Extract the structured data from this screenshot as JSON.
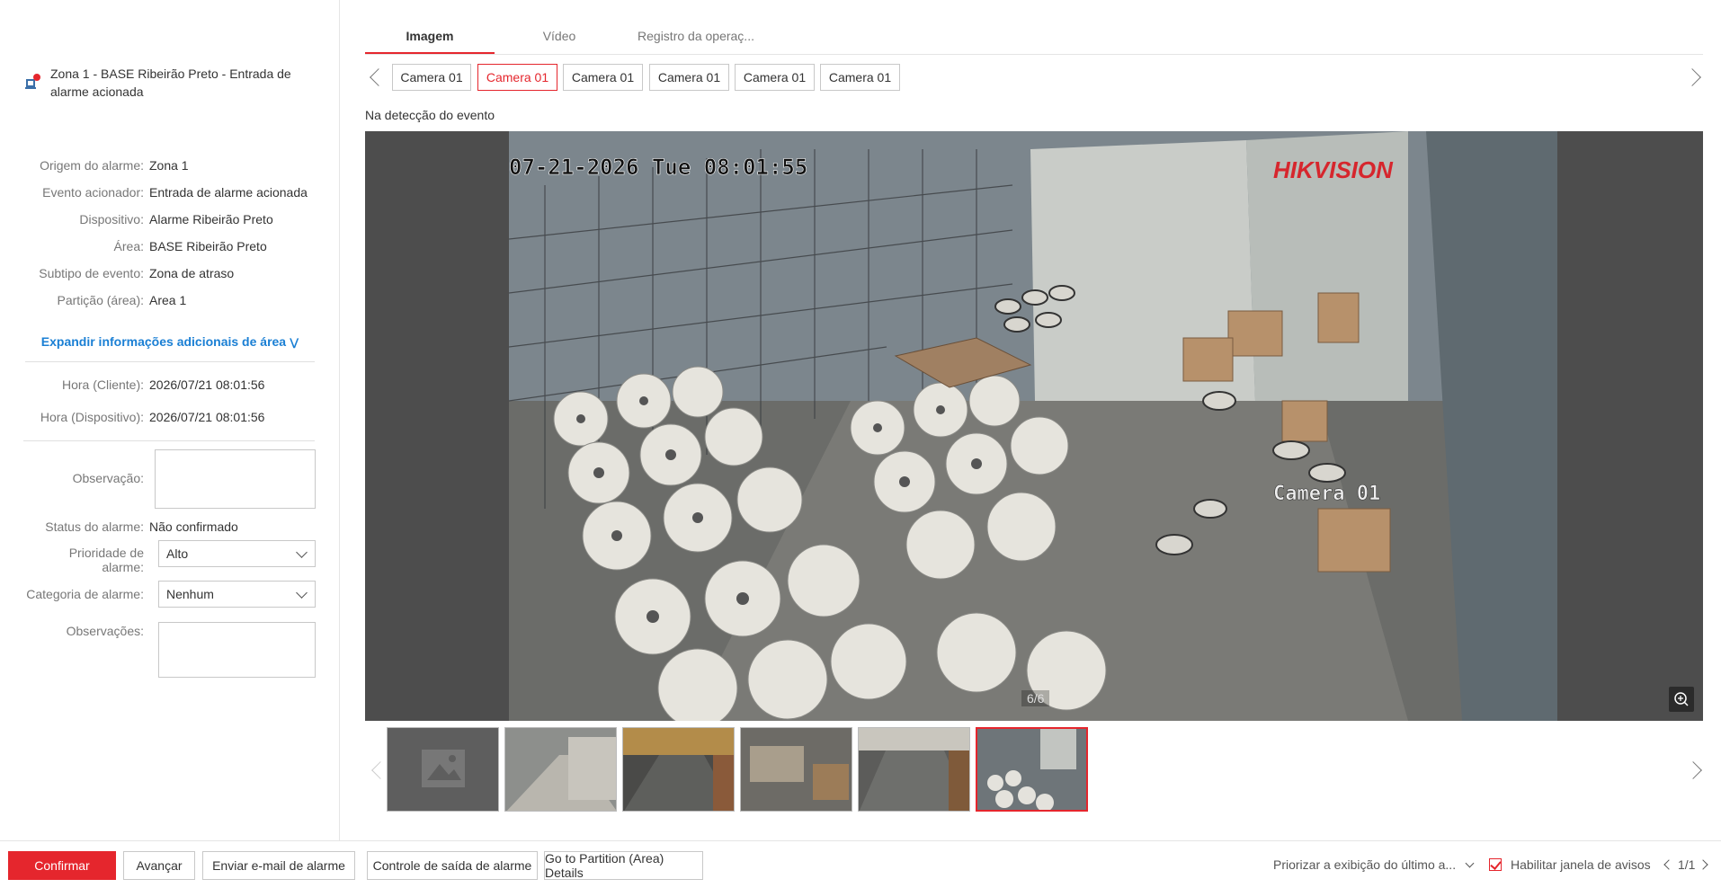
{
  "alarm": {
    "title": "Zona 1 - BASE Ribeirão Preto - Entrada de alarme acionada",
    "icon": "alarm-input-icon"
  },
  "details": [
    {
      "label": "Origem do alarme:",
      "value": "Zona 1"
    },
    {
      "label": "Evento acionador:",
      "value": "Entrada de alarme acionada"
    },
    {
      "label": "Dispositivo:",
      "value": "Alarme Ribeirão Preto"
    },
    {
      "label": "Área:",
      "value": "BASE Ribeirão Preto"
    },
    {
      "label": "Subtipo de evento:",
      "value": "Zona de atraso"
    },
    {
      "label": "Partição (área):",
      "value": "Area 1"
    }
  ],
  "expand_label": "Expandir informações adicionais de área",
  "times": [
    {
      "label": "Hora (Cliente):",
      "value": "2026/07/21 08:01:56"
    },
    {
      "label": "Hora (Dispositivo):",
      "value": "2026/07/21 08:01:56"
    }
  ],
  "form": {
    "observation_label": "Observação:",
    "observation_value": "",
    "status_label": "Status do alarme:",
    "status_value": "Não confirmado",
    "priority_label": "Prioridade de alarme:",
    "priority_value": "Alto",
    "category_label": "Categoria de alarme:",
    "category_value": "Nenhum",
    "remarks_label": "Observações:",
    "remarks_value": ""
  },
  "tabs": [
    {
      "label": "Imagem",
      "active": true
    },
    {
      "label": "Vídeo",
      "active": false
    },
    {
      "label": "Registro da operaç...",
      "active": false
    }
  ],
  "cameras": [
    {
      "label": "Camera 01",
      "active": false
    },
    {
      "label": "Camera 01",
      "active": true
    },
    {
      "label": "Camera 01",
      "active": false
    },
    {
      "label": "Camera 01",
      "active": false
    },
    {
      "label": "Camera 01",
      "active": false
    },
    {
      "label": "Camera 01",
      "active": false
    }
  ],
  "detection_label": "Na detecção do evento",
  "viewer": {
    "osd_timestamp": "07-21-2026 Tue 08:01:55",
    "brand_watermark": "HIKVISION",
    "osd_camera_name": "Camera 01",
    "counter": "6/6"
  },
  "thumbnails": [
    {
      "kind": "placeholder",
      "active": false
    },
    {
      "kind": "corridor",
      "active": false
    },
    {
      "kind": "street-sunset",
      "active": false
    },
    {
      "kind": "warehouse",
      "active": false
    },
    {
      "kind": "street-day",
      "active": false
    },
    {
      "kind": "warehouse-cage",
      "active": true
    }
  ],
  "bottom": {
    "confirm": "Confirmar",
    "next": "Avançar",
    "email": "Enviar e-mail de alarme",
    "output": "Controle de saída de alarme",
    "partition": "Go to Partition (Area) Details",
    "priority_display": "Priorizar a exibição do último a...",
    "enable_popup": "Habilitar janela de avisos",
    "enable_popup_checked": true,
    "pager": "1/1"
  },
  "colors": {
    "accent": "#e5262d",
    "link": "#1a7fd4"
  }
}
